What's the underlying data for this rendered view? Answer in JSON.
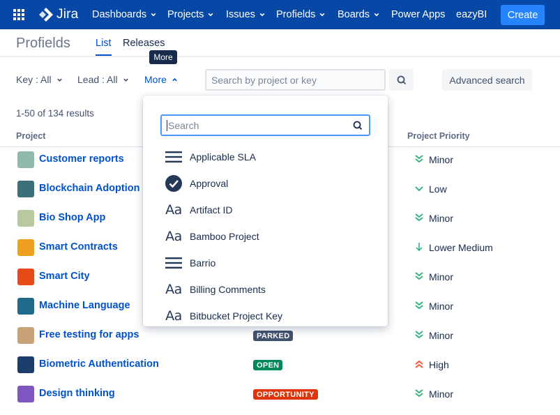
{
  "nav": {
    "logo_text": "Jira",
    "items": [
      {
        "label": "Dashboards",
        "has_chevron": true
      },
      {
        "label": "Projects",
        "has_chevron": true
      },
      {
        "label": "Issues",
        "has_chevron": true
      },
      {
        "label": "Profields",
        "has_chevron": true
      },
      {
        "label": "Boards",
        "has_chevron": true
      },
      {
        "label": "Power Apps",
        "has_chevron": false
      },
      {
        "label": "eazyBI",
        "has_chevron": false
      }
    ],
    "create_label": "Create",
    "colors": {
      "bar": "#0747a6",
      "create": "#2684ff"
    }
  },
  "header": {
    "title": "Profields",
    "tabs": [
      {
        "label": "List",
        "active": true
      },
      {
        "label": "Releases",
        "active": false
      }
    ],
    "tooltip": "More"
  },
  "filters": {
    "key": "Key : All",
    "lead": "Lead : All",
    "more": "More",
    "search_placeholder": "Search by project or key",
    "advanced_label": "Advanced search"
  },
  "results": {
    "summary": "1-50 of 134 results",
    "columns": {
      "project": "Project",
      "priority": "Project Priority"
    },
    "rows": [
      {
        "name": "Customer reports",
        "status": "",
        "status_color": "",
        "priority": "Minor",
        "priority_icon": "double-chevron-down-icon",
        "avatar_color": "#8fb9a8"
      },
      {
        "name": "Blockchain Adoption",
        "status": "",
        "status_color": "",
        "priority": "Low",
        "priority_icon": "chevron-down-icon",
        "avatar_color": "#3d6f7a"
      },
      {
        "name": "Bio Shop App",
        "status": "",
        "status_color": "",
        "priority": "Minor",
        "priority_icon": "double-chevron-down-icon",
        "avatar_color": "#b8c9a0"
      },
      {
        "name": "Smart Contracts",
        "status": "",
        "status_color": "",
        "priority": "Lower Medium",
        "priority_icon": "arrow-down-icon",
        "avatar_color": "#f0a020"
      },
      {
        "name": "Smart City",
        "status": "",
        "status_color": "",
        "priority": "Minor",
        "priority_icon": "double-chevron-down-icon",
        "avatar_color": "#e64a19"
      },
      {
        "name": "Machine Language",
        "status": "",
        "status_color": "",
        "priority": "Minor",
        "priority_icon": "double-chevron-down-icon",
        "avatar_color": "#1f6a8a"
      },
      {
        "name": "Free testing for apps",
        "status": "PARKED",
        "status_color": "#42526e",
        "priority": "Minor",
        "priority_icon": "double-chevron-down-icon",
        "avatar_color": "#c9a27a"
      },
      {
        "name": "Biometric Authentication",
        "status": "OPEN",
        "status_color": "#00875a",
        "priority": "High",
        "priority_icon": "double-chevron-up-icon",
        "avatar_color": "#1a3d6b"
      },
      {
        "name": "Design thinking",
        "status": "OPPORTUNITY",
        "status_color": "#de350b",
        "priority": "Minor",
        "priority_icon": "double-chevron-down-icon",
        "avatar_color": "#7e57c2"
      }
    ]
  },
  "dropdown": {
    "search_placeholder": "Search",
    "items": [
      {
        "label": "Applicable SLA",
        "icon": "list-lines-icon"
      },
      {
        "label": "Approval",
        "icon": "check-circle-icon"
      },
      {
        "label": "Artifact ID",
        "icon": "text-aa-icon"
      },
      {
        "label": "Bamboo Project",
        "icon": "text-aa-icon"
      },
      {
        "label": "Barrio",
        "icon": "list-lines-icon"
      },
      {
        "label": "Billing Comments",
        "icon": "text-aa-icon"
      },
      {
        "label": "Bitbucket Project Key",
        "icon": "text-aa-icon"
      }
    ],
    "aa_glyph": "Aa"
  },
  "colors": {
    "minor": "#36b37e",
    "low": "#36b37e",
    "high": "#ff5630",
    "link": "#0052cc"
  }
}
